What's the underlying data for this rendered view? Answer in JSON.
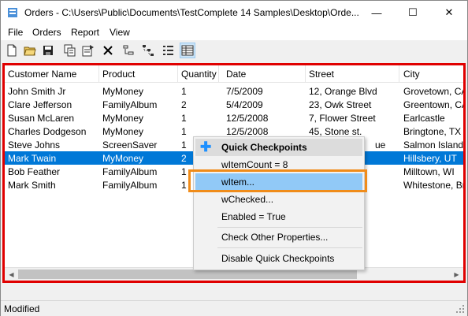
{
  "window": {
    "title": "Orders - C:\\Users\\Public\\Documents\\TestComplete 14 Samples\\Desktop\\Orde...",
    "icon": "app-icon",
    "minimize_glyph": "—",
    "maximize_glyph": "☐",
    "close_glyph": "✕"
  },
  "menu": {
    "items": [
      {
        "label": "File"
      },
      {
        "label": "Orders"
      },
      {
        "label": "Report"
      },
      {
        "label": "View"
      }
    ]
  },
  "toolbar": {
    "buttons": [
      "new-icon",
      "open-icon",
      "save-icon",
      "copy-icon",
      "properties-icon",
      "delete-icon",
      "sort-icon",
      "tree-icon",
      "list-icon",
      "details-icon"
    ]
  },
  "grid": {
    "columns": [
      "Customer Name",
      "Product",
      "Quantity",
      "Date",
      "Street",
      "City"
    ],
    "rows": [
      [
        "John Smith Jr",
        "MyMoney",
        "1",
        "7/5/2009",
        "12, Orange Blvd",
        "Grovetown, CA"
      ],
      [
        "Clare Jefferson",
        "FamilyAlbum",
        "2",
        "5/4/2009",
        "23, Owk Street",
        "Greentown, CA"
      ],
      [
        "Susan McLaren",
        "MyMoney",
        "1",
        "12/5/2008",
        "7, Flower Street",
        "Earlcastle"
      ],
      [
        "Charles Dodgeson",
        "MyMoney",
        "1",
        "12/5/2008",
        "45, Stone st.",
        "Bringtone, TX"
      ],
      [
        "Steve Johns",
        "ScreenSaver",
        "1",
        "",
        "ue",
        "Salmon Island"
      ],
      [
        "Mark Twain",
        "MyMoney",
        "2",
        "",
        "",
        "Hillsbery, UT"
      ],
      [
        "Bob Feather",
        "FamilyAlbum",
        "1",
        "",
        "",
        "Milltown, WI"
      ],
      [
        "Mark Smith",
        "FamilyAlbum",
        "1",
        "",
        "",
        "Whitestone, Britis"
      ]
    ],
    "selected_row": 5
  },
  "context_menu": {
    "header": "Quick Checkpoints",
    "items": {
      "item_count": "wItemCount = 8",
      "witem": "wItem...",
      "wchecked": "wChecked...",
      "enabled": "Enabled = True",
      "check_other": "Check Other Properties...",
      "disable": "Disable Quick Checkpoints"
    }
  },
  "statusbar": {
    "text": "Modified"
  },
  "colors": {
    "highlight_frame": "#e00000",
    "hover_box": "#f08c1a",
    "selection": "#0078d7"
  }
}
